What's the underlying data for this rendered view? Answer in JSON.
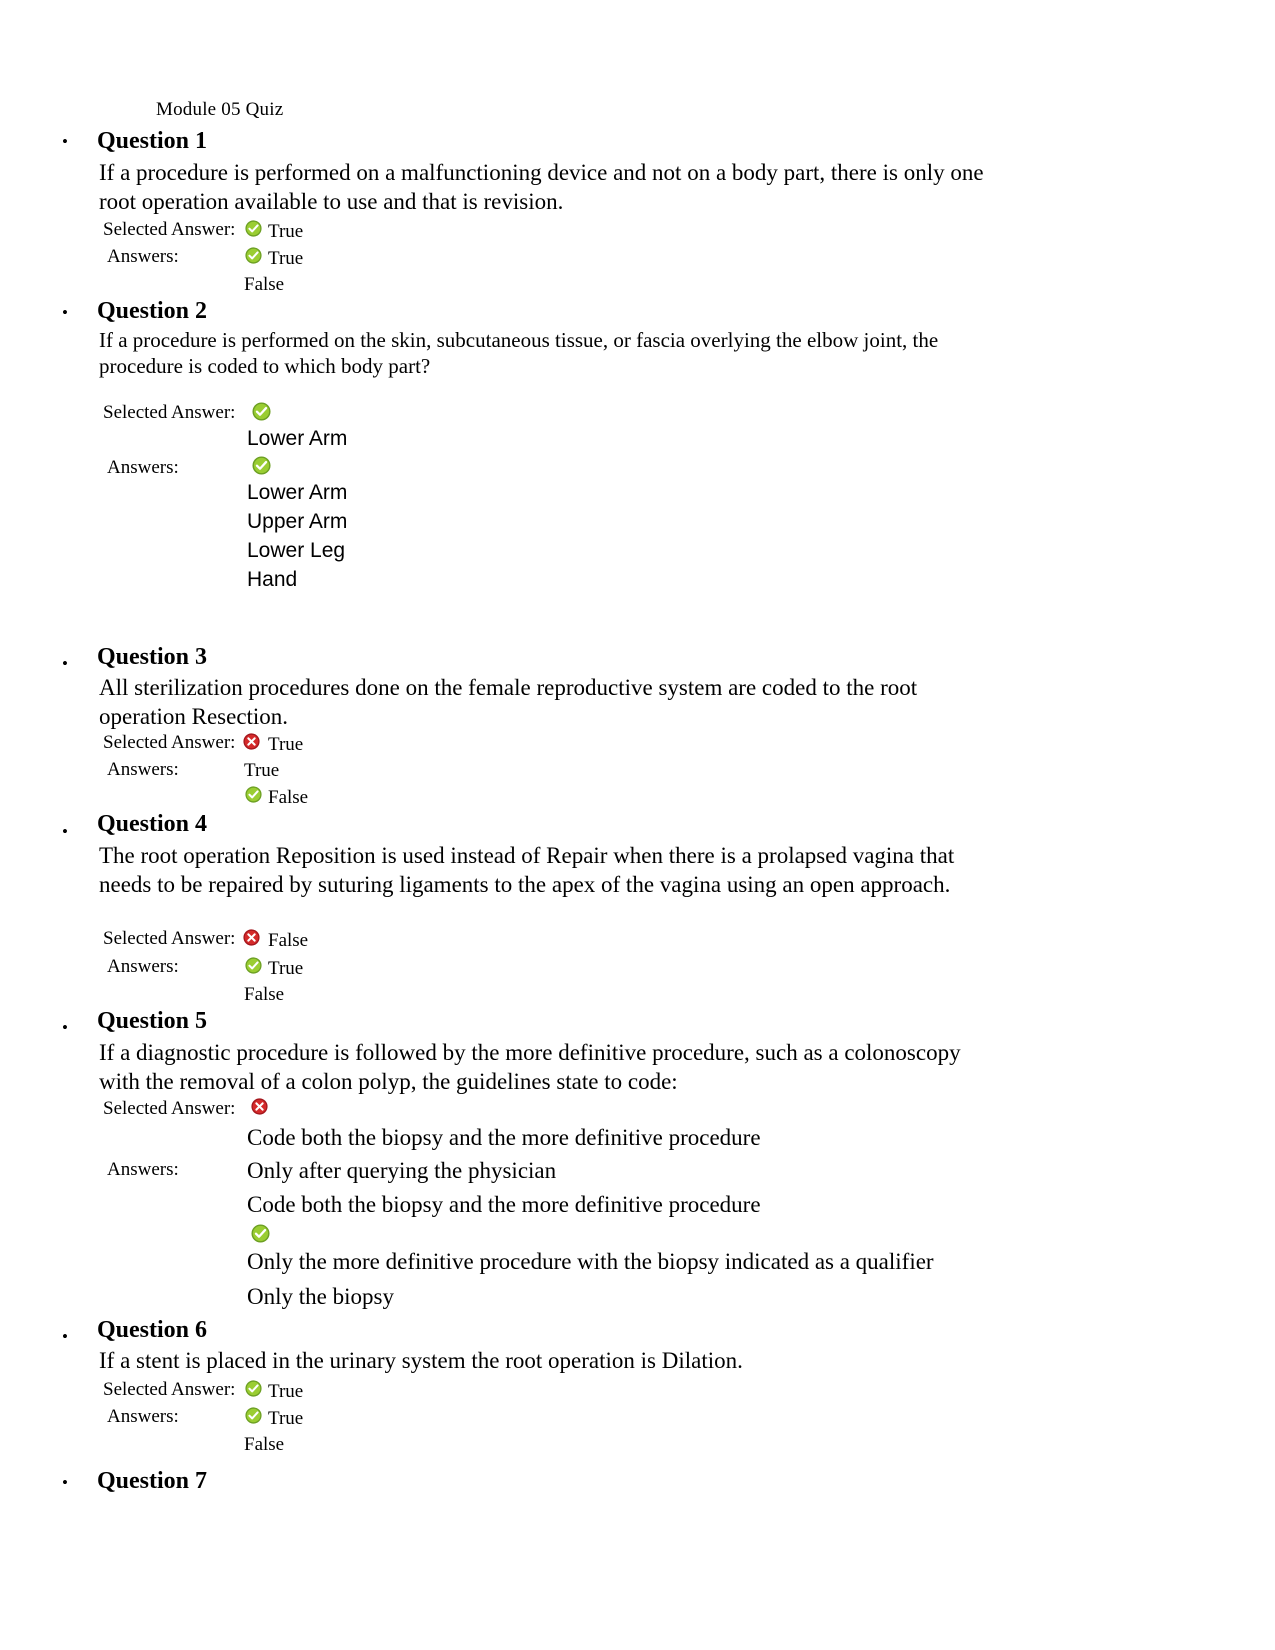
{
  "document": {
    "title": "Module 05 Quiz",
    "labels": {
      "selected_answer": "Selected Answer:",
      "answers": "Answers:"
    },
    "icons": {
      "correct": "green-check-icon",
      "incorrect": "red-x-icon"
    },
    "colors": {
      "correct_green": "#8DC63F",
      "correct_green_dark": "#6C9F23",
      "incorrect_red": "#CC2029",
      "incorrect_red_dark": "#A3151C",
      "text": "#000000",
      "page_background": "#FFFFFF"
    }
  },
  "questions": [
    {
      "number": "Question 1",
      "text": "If a procedure is performed on a malfunctioning device and not on a body part, there is only one root operation available to use and that is revision.",
      "selected": {
        "status": "correct",
        "text": "True"
      },
      "answers": [
        {
          "status": "correct",
          "text": "True"
        },
        {
          "status": "none",
          "text": "False"
        }
      ]
    },
    {
      "number": "Question 2",
      "text": "If a procedure is performed on the skin, subcutaneous tissue, or fascia overlying the elbow joint, the procedure is coded to which body part?",
      "selected": {
        "status": "correct",
        "text": "Lower Arm"
      },
      "answers": [
        {
          "status": "correct",
          "text": "Lower Arm"
        },
        {
          "status": "none",
          "text": "Upper Arm"
        },
        {
          "status": "none",
          "text": "Lower Leg"
        },
        {
          "status": "none",
          "text": "Hand"
        }
      ]
    },
    {
      "number": "Question 3",
      "text": "All sterilization procedures done on the female reproductive system are coded to the root operation Resection.",
      "selected": {
        "status": "incorrect",
        "text": "True"
      },
      "answers": [
        {
          "status": "none",
          "text": "True"
        },
        {
          "status": "correct",
          "text": "False"
        }
      ]
    },
    {
      "number": "Question 4",
      "text": "The root operation Reposition is used instead of Repair when there is a prolapsed vagina that needs to be repaired by suturing ligaments to the apex of the vagina using an open approach.",
      "selected": {
        "status": "incorrect",
        "text": "False"
      },
      "answers": [
        {
          "status": "correct",
          "text": "True"
        },
        {
          "status": "none",
          "text": "False"
        }
      ]
    },
    {
      "number": "Question 5",
      "text": "If a diagnostic procedure is followed by the more definitive procedure, such as a colonoscopy with the removal of a colon polyp, the guidelines state to code:",
      "selected": {
        "status": "incorrect",
        "text": "Code both the biopsy and the more definitive procedure"
      },
      "answers": [
        {
          "status": "none",
          "text": "Only after querying the physician"
        },
        {
          "status": "none",
          "text": "Code both the biopsy and the more definitive procedure"
        },
        {
          "status": "correct",
          "text": "Only the more definitive procedure with the biopsy indicated as a qualifier"
        },
        {
          "status": "none",
          "text": "Only the biopsy"
        }
      ]
    },
    {
      "number": "Question 6",
      "text": "If a stent is placed in the urinary system the root operation is Dilation.",
      "selected": {
        "status": "correct",
        "text": "True"
      },
      "answers": [
        {
          "status": "correct",
          "text": "True"
        },
        {
          "status": "none",
          "text": "False"
        }
      ]
    },
    {
      "number": "Question 7",
      "text": "",
      "selected": null,
      "answers": []
    }
  ]
}
